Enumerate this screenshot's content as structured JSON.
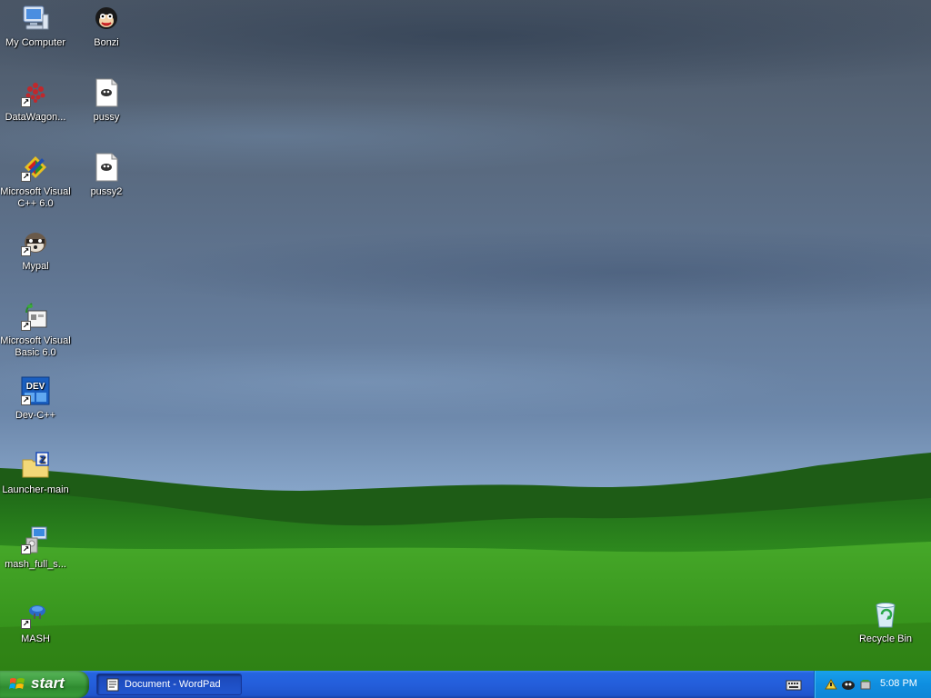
{
  "desktop": {
    "icons_left": [
      {
        "label": "My Computer",
        "icon": "my-computer-icon"
      },
      {
        "label": "DataWagon...",
        "icon": "datawagon-icon"
      },
      {
        "label": "Microsoft Visual C++ 6.0",
        "icon": "visual-cpp-icon"
      },
      {
        "label": "Mypal",
        "icon": "mypal-icon"
      },
      {
        "label": "Microsoft Visual Basic 6.0",
        "icon": "visual-basic-icon"
      },
      {
        "label": "Dev-C++",
        "icon": "dev-cpp-icon",
        "badge": "DEV"
      },
      {
        "label": "Launcher-main",
        "icon": "folder-icon",
        "badge": "Z"
      },
      {
        "label": "mash_full_s...",
        "icon": "installer-icon"
      },
      {
        "label": "MASH",
        "icon": "mash-icon"
      }
    ],
    "icons_right": [
      {
        "label": "Bonzi",
        "icon": "bonzi-icon"
      },
      {
        "label": "pussy",
        "icon": "file-icon"
      },
      {
        "label": "pussy2",
        "icon": "file-icon"
      }
    ],
    "recycle_bin": {
      "label": "Recycle Bin",
      "icon": "recycle-bin-icon"
    }
  },
  "taskbar": {
    "start_label": "start",
    "tasks": [
      {
        "label": "Document - WordPad",
        "icon": "wordpad-icon"
      }
    ],
    "tray": {
      "icons": [
        "network-icon",
        "bonzi-tray-icon",
        "safely-remove-icon"
      ],
      "clock": "5:08 PM"
    }
  }
}
